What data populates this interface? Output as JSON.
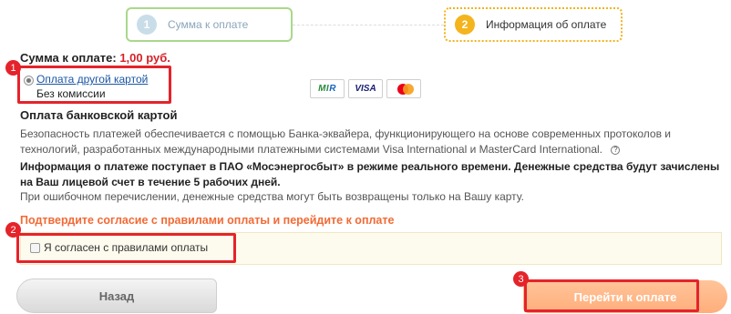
{
  "steps": [
    {
      "number": "1",
      "label": "Сумма к оплате"
    },
    {
      "number": "2",
      "label": "Информация об оплате"
    }
  ],
  "amount": {
    "label": "Сумма к оплате:",
    "value": "1,00 руб."
  },
  "payment_option": {
    "link": "Оплата другой картой",
    "sub": "Без комиссии",
    "selected": true
  },
  "cards": {
    "mir": "MIR",
    "visa": "VISA",
    "mastercard": "MasterCard"
  },
  "bank_section": {
    "title": "Оплата банковской картой",
    "security_text": "Безопасность платежей обеспечивается с помощью Банка-эквайера, функционирующего на основе современных протоколов и технологий, разработанных международными платежными системами Visa International и MasterCard International.",
    "info_text": "Информация о платеже поступает в ПАО «Мосэнергосбыт» в режиме реального времени. Денежные средства будут зачислены на Ваш лицевой счет в течение 5 рабочих дней.",
    "refund_text": "При ошибочном перечислении, денежные средства могут быть возвращены только на Вашу карту.",
    "help_symbol": "?"
  },
  "agreement": {
    "title": "Подтвердите согласие с правилами оплаты и перейдите к оплате",
    "checkbox_label": "Я согласен с правилами оплаты",
    "checked": false
  },
  "buttons": {
    "back": "Назад",
    "pay": "Перейти к оплате"
  },
  "annotations": [
    "1",
    "2",
    "3"
  ],
  "colors": {
    "highlight": "#e5232a",
    "accent": "#f26a35",
    "amount": "#d62128",
    "step_active": "#f4b41e",
    "step_done": "#a9d88b"
  }
}
